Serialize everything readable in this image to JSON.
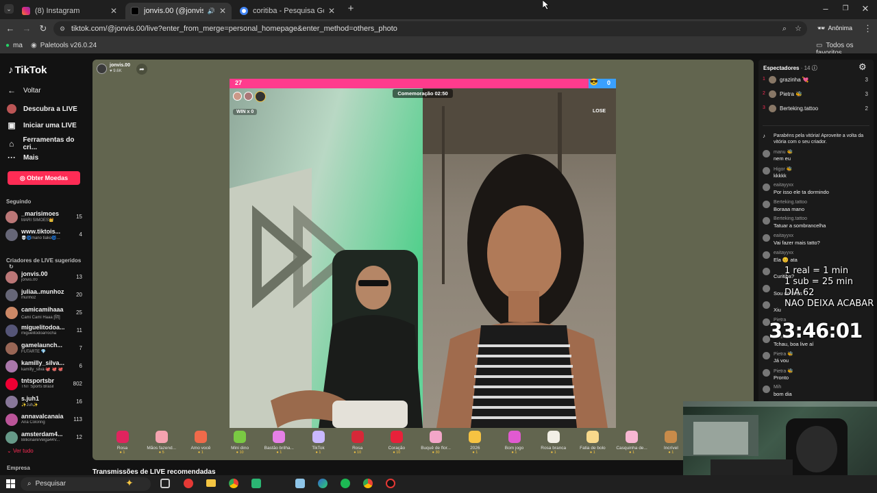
{
  "browser": {
    "tabs": [
      {
        "title": "(8) Instagram",
        "color": "#e1306c"
      },
      {
        "title": "jonvis.00 (@jonvis.00) com",
        "color": "#111111"
      },
      {
        "title": "coritiba - Pesquisa Google",
        "color": "#4285f4"
      }
    ],
    "url": "tiktok.com/@jonvis.00/live?enter_from_merge=personal_homepage&enter_method=others_photo",
    "profile_label": "Anônima",
    "bookmarks": [
      {
        "label": "ma"
      },
      {
        "label": "Paletools v26.0.24"
      }
    ],
    "all_favorites": "Todos os favoritos"
  },
  "tiktok": {
    "logo": "TikTok",
    "back": "Voltar",
    "nav": [
      "Descubra a LIVE",
      "Iniciar uma LIVE",
      "Ferramentas do cri...",
      "Mais"
    ],
    "coins_button": "Obter Moedas",
    "following_header": "Seguindo",
    "following": [
      {
        "name": "_marisimoes",
        "sub": "MARI SIMÕES👑",
        "count": "15"
      },
      {
        "name": "www.tiktois...",
        "sub": "💀🌀mano tiako🌀...",
        "count": "4"
      }
    ],
    "suggested_header": "Criadores de LIVE sugeridos",
    "suggested": [
      {
        "name": "jonvis.00",
        "sub": "jonvis.00",
        "count": "13"
      },
      {
        "name": "juliaa..munhoz",
        "sub": "munhoz",
        "count": "20"
      },
      {
        "name": "camicamihaaa",
        "sub": "Cami Cami Haaa [阴]",
        "count": "25"
      },
      {
        "name": "miguelitodoa...",
        "sub": "miguelitodoarrocha",
        "count": "11"
      },
      {
        "name": "gamelaunch...",
        "sub": "FUTARTE 💎",
        "count": "7"
      },
      {
        "name": "kamilly_silva...",
        "sub": "kamilly_silva 🐙 🐙 🐙",
        "count": "6"
      },
      {
        "name": "tntsportsbr",
        "sub": "TNT Sports Brasil",
        "count": "802"
      },
      {
        "name": "s.juh1",
        "sub": "✨Juh✨",
        "count": "16"
      },
      {
        "name": "annavalcanaia",
        "sub": "Ana Coloring",
        "count": "113"
      },
      {
        "name": "amsterdam4...",
        "sub": "BillionaireVelga44V...",
        "count": "12"
      }
    ],
    "see_all": "Ver tudo",
    "company": "Empresa",
    "recommended": "Transmissões de LIVE recomendadas"
  },
  "live": {
    "host_name": "jonvis.00",
    "host_likes": "9.6K",
    "score_left": "27",
    "score_right": "0",
    "timer": "Comemoração 02:50",
    "win_label": "WIN x 0",
    "lose_label": "LOSE",
    "gifts": [
      {
        "name": "Rosa",
        "price": "1",
        "color": "#e0245e"
      },
      {
        "name": "Mãos fazend...",
        "price": "5",
        "color": "#f5a3b0"
      },
      {
        "name": "Amo você",
        "price": "1",
        "color": "#f06a4a"
      },
      {
        "name": "Mini dino",
        "price": "10",
        "color": "#7ac943"
      },
      {
        "name": "Bastão brilha...",
        "price": "1",
        "color": "#e580e6"
      },
      {
        "name": "TikTok",
        "price": "1",
        "color": "#c9b8ff"
      },
      {
        "name": "Rosa",
        "price": "10",
        "color": "#d62838"
      },
      {
        "name": "Coração",
        "price": "10",
        "color": "#e8213a"
      },
      {
        "name": "Buquê de flor...",
        "price": "30",
        "color": "#f3a6c8"
      },
      {
        "name": "2026",
        "price": "1",
        "color": "#f6c342"
      },
      {
        "name": "Bom jogo",
        "price": "1",
        "color": "#e15ad1"
      },
      {
        "name": "Rosa branca",
        "price": "1",
        "color": "#f2efe6"
      },
      {
        "name": "Fatia de bolo",
        "price": "1",
        "color": "#f7d88b"
      },
      {
        "name": "Casquinha de...",
        "price": "1",
        "color": "#f7b6d2"
      },
      {
        "name": "Incrível",
        "price": "1",
        "color": "#c88b4a"
      }
    ]
  },
  "chat": {
    "viewers_title": "Espectadores",
    "viewers_count": "· 14",
    "top_viewers": [
      {
        "rank": "1",
        "name": "grazinha 💘",
        "score": "3"
      },
      {
        "rank": "2",
        "name": "Pietra 🐝",
        "score": "3"
      },
      {
        "rank": "3",
        "name": "Berteking.tattoo",
        "score": "2"
      }
    ],
    "system_msg": "Parabéns pela vitória! Aproveite a volta da vitória com o seu criador.",
    "messages": [
      {
        "user": "manu 🐝",
        "text": "nem eu"
      },
      {
        "user": "Higor 🐝",
        "text": "kkkkk"
      },
      {
        "user": "eaitayyxx",
        "text": "Por isso ele ta dormindo"
      },
      {
        "user": "Berteking.tattoo",
        "text": "Boraaa mano"
      },
      {
        "user": "Berteking.tattoo",
        "text": "Tatuar a sombrancelha"
      },
      {
        "user": "eaitayyxx",
        "text": "Vai fazer mais tatto?"
      },
      {
        "user": "eaitayyxx",
        "text": "Ela 😊 ata"
      },
      {
        "user": "",
        "text": "Curitiba?"
      },
      {
        "user": "",
        "text": "Sou do lates"
      },
      {
        "user": "",
        "text": "Xiu"
      },
      {
        "user": "Pietra",
        "text": ""
      },
      {
        "user": "Pietra",
        "text": "Tchau, boa live aí"
      },
      {
        "user": "Pietra 🐝",
        "text": "Já vou"
      },
      {
        "user": "Pietra 🐝",
        "text": "Pronto"
      },
      {
        "user": "Mih",
        "text": "bom dia"
      }
    ]
  },
  "overlay": {
    "line1": "1 real = 1 min",
    "line2": "1 sub = 25 min",
    "line3": "DIA 62",
    "line4": "NAO DEIXA ACABAR",
    "timer": "33:46:01"
  },
  "taskbar": {
    "search": "Pesquisar"
  }
}
